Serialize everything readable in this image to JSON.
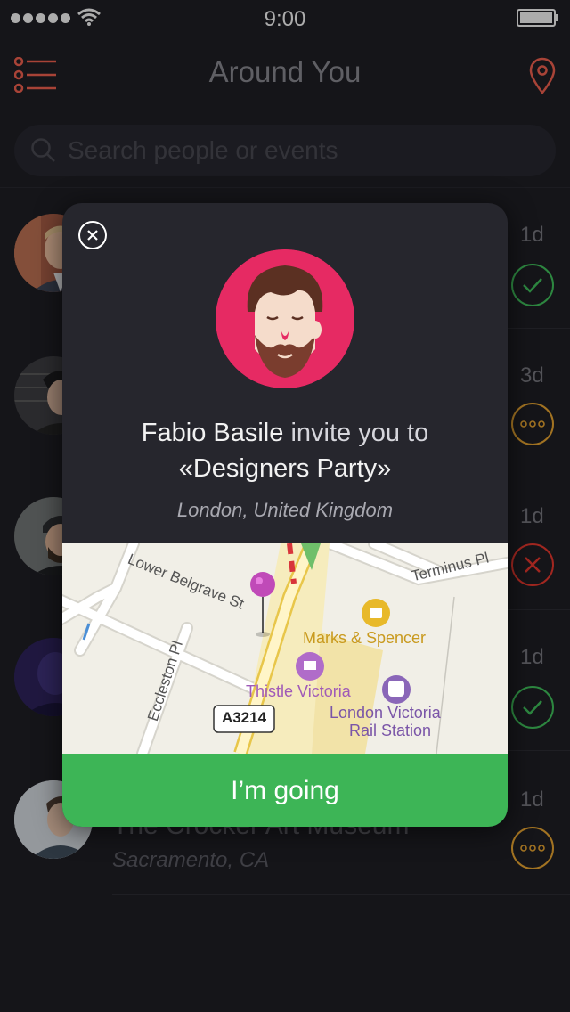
{
  "status_bar": {
    "time": "9:00"
  },
  "nav": {
    "title": "Around You"
  },
  "search": {
    "placeholder": "Search people or events"
  },
  "list": {
    "items": [
      {
        "age": "1d",
        "status": "accepted"
      },
      {
        "age": "3d",
        "status": "pending"
      },
      {
        "age": "1d",
        "status": "declined"
      },
      {
        "age": "1d",
        "status": "accepted"
      },
      {
        "age": "1d",
        "status": "pending",
        "title": "The Crocker Art Museum",
        "location": "Sacramento, CA"
      }
    ]
  },
  "modal": {
    "inviter": "Fabio Basile",
    "invite_text": "invite you to",
    "event": "«Designers Party»",
    "location": "London, United Kingdom",
    "map": {
      "labels": {
        "lower_belgrave": "Lower Belgrave St",
        "terminus": "Terminus Pl",
        "eccleston": "Eccleston Pl",
        "marks": "Marks & Spencer",
        "thistle": "Thistle Victoria",
        "station_1": "London Victoria",
        "station_2": "Rail Station",
        "road": "A3214"
      }
    },
    "button_label": "I’m going"
  },
  "colors": {
    "accent": "#e05a4a",
    "accepted": "#3db556",
    "pending": "#d99a2e",
    "declined": "#d9342b",
    "go_button": "#3db556",
    "avatar_bg": "#e62a63"
  }
}
